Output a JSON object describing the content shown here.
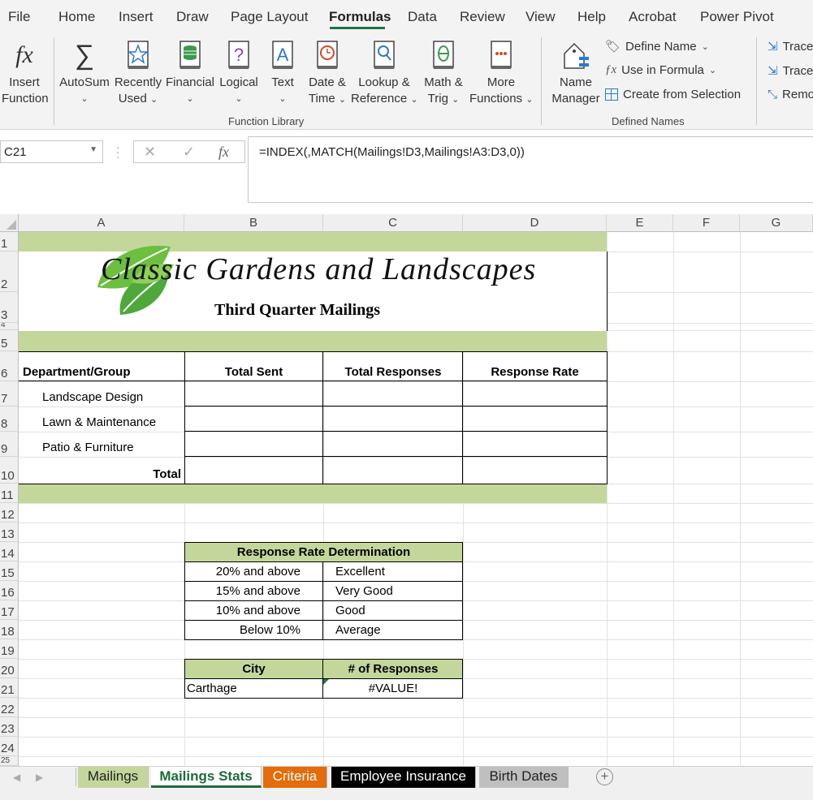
{
  "menu": {
    "tabs": [
      "File",
      "Home",
      "Insert",
      "Draw",
      "Page Layout",
      "Formulas",
      "Data",
      "Review",
      "View",
      "Help",
      "Acrobat",
      "Power Pivot"
    ],
    "active": "Formulas"
  },
  "ribbon": {
    "insert_function": [
      "Insert",
      "Function"
    ],
    "autosum": "AutoSum",
    "recently_used": [
      "Recently",
      "Used"
    ],
    "financial": "Financial",
    "logical": "Logical",
    "text": "Text",
    "date_time": [
      "Date &",
      "Time"
    ],
    "lookup": [
      "Lookup &",
      "Reference"
    ],
    "math": [
      "Math &",
      "Trig"
    ],
    "more": [
      "More",
      "Functions"
    ],
    "function_library_label": "Function Library",
    "name_manager": [
      "Name",
      "Manager"
    ],
    "define_name": "Define Name",
    "use_in_formula": "Use in Formula",
    "create_from_selection": "Create from Selection",
    "defined_names_label": "Defined Names",
    "trace_precedents": "Trace",
    "trace_dependents": "Trace",
    "remove_arrows": "Remo"
  },
  "formula_bar": {
    "name_box": "C21",
    "formula": "=INDEX(,MATCH(Mailings!D3,Mailings!A3:D3,0))"
  },
  "columns": [
    "A",
    "B",
    "C",
    "D",
    "E",
    "F",
    "G"
  ],
  "rows": [
    "1",
    "2",
    "3",
    "4",
    "5",
    "6",
    "7",
    "8",
    "9",
    "10",
    "11",
    "12",
    "13",
    "14",
    "15",
    "16",
    "17",
    "18",
    "19",
    "20",
    "21",
    "22",
    "23",
    "24",
    "25"
  ],
  "sheet": {
    "logo_text": "Classic Gardens and Landscapes",
    "subtitle": "Third Quarter Mailings",
    "headers": [
      "Department/Group",
      "Total Sent",
      "Total Responses",
      "Response Rate"
    ],
    "departments": [
      "Landscape Design",
      "Lawn & Maintenance",
      "Patio & Furniture"
    ],
    "total_label": "Total",
    "rate_title": "Response Rate Determination",
    "rate_rows": [
      {
        "threshold": "20% and above",
        "label": "Excellent"
      },
      {
        "threshold": "15% and above",
        "label": "Very Good"
      },
      {
        "threshold": "10% and above",
        "label": "Good"
      },
      {
        "threshold": "Below 10%",
        "label": "Average"
      }
    ],
    "city_header": "City",
    "responses_header": "# of Responses",
    "city_value": "Carthage",
    "responses_value": "#VALUE!"
  },
  "sheet_tabs": [
    {
      "name": "Mailings",
      "bg": "#c4d79b",
      "color": "#222"
    },
    {
      "name": "Mailings Stats",
      "bg": "#c4d79b",
      "color": "#1e6b3a"
    },
    {
      "name": "Criteria",
      "bg": "#e46c0a",
      "color": "#ffffff"
    },
    {
      "name": "Employee Insurance",
      "bg": "#000000",
      "color": "#ffffff"
    },
    {
      "name": "Birth Dates",
      "bg": "#bfbfbf",
      "color": "#222"
    }
  ],
  "colors": {
    "accent": "#217346",
    "band": "#c4d79b",
    "leaf": "#6cbf3f"
  }
}
